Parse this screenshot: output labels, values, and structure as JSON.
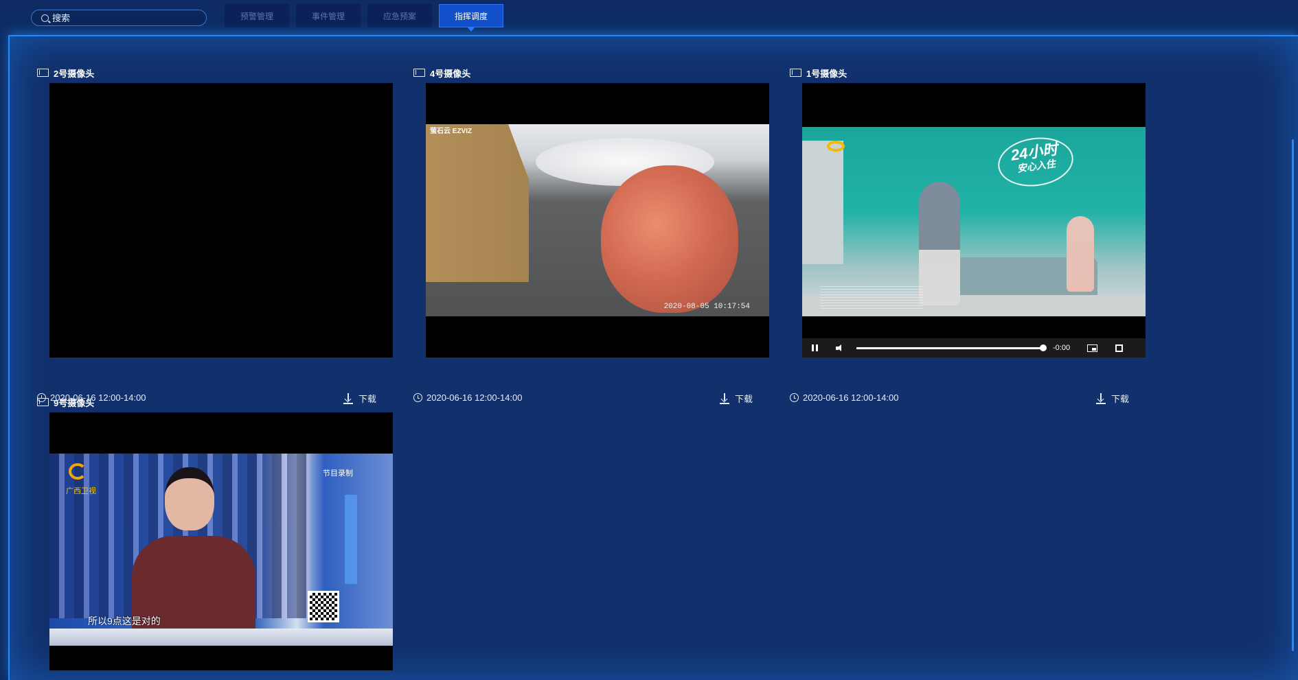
{
  "search": {
    "placeholder": "搜索"
  },
  "tabs": [
    {
      "label": "预警管理",
      "active": false
    },
    {
      "label": "事件管理",
      "active": false
    },
    {
      "label": "应急预案",
      "active": false
    },
    {
      "label": "指挥调度",
      "active": true
    }
  ],
  "colors": {
    "background": "#0e2c63",
    "panel": "#12306b",
    "accent": "#1f8cff",
    "active_tab": "#1150c9",
    "inactive_tab_text": "#5a77ad"
  },
  "cameras": [
    {
      "title": "2号摄像头",
      "time_range": "2020-06-16 12:00-14:00",
      "download_label": "下载",
      "feed": "blank"
    },
    {
      "title": "4号摄像头",
      "time_range": "2020-06-16 12:00-14:00",
      "download_label": "下载",
      "feed": "apple",
      "overlay_logo": "萤石云 EZVIZ",
      "overlay_timestamp": "2020-08-05 10:17:54"
    },
    {
      "title": "1号摄像头",
      "time_range": "2020-06-16 12:00-14:00",
      "download_label": "下载",
      "feed": "family-ad",
      "ad_badge_big": "24小时",
      "ad_badge_small": "安心入住",
      "player": {
        "time_remaining": "-0:00",
        "progress": 1.0
      }
    },
    {
      "title": "9号摄像头",
      "feed": "tv-host",
      "tv_logo_text": "广西卫视",
      "rec_label": "节目录制",
      "subtitle": "所以9点这是对的"
    }
  ],
  "icons": [
    "search-icon",
    "camera-icon",
    "clock-icon",
    "download-icon",
    "pause-icon",
    "volume-icon",
    "pip-icon",
    "fullscreen-icon"
  ]
}
